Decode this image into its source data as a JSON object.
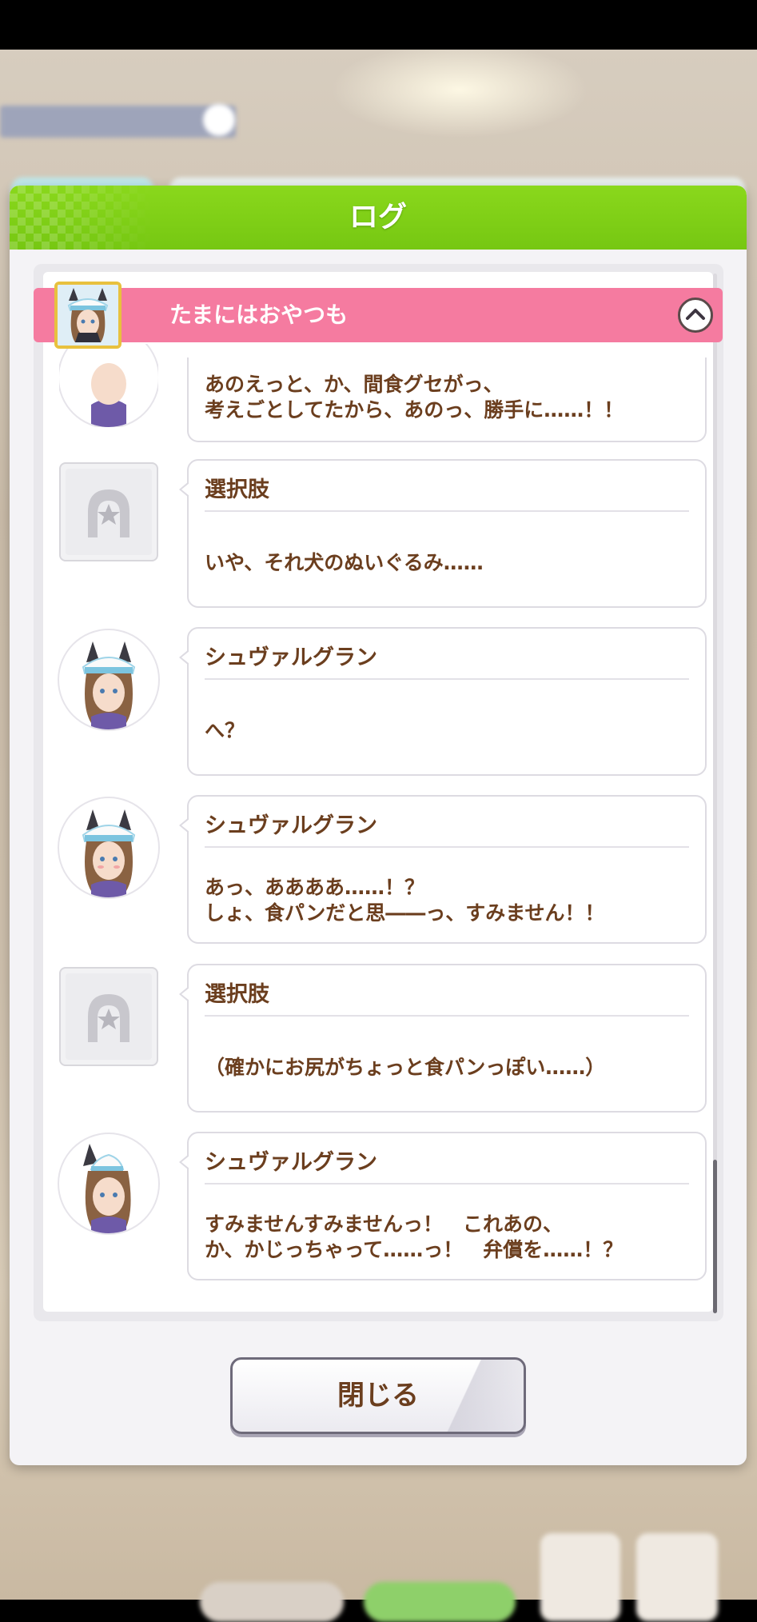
{
  "dialog": {
    "title": "ログ",
    "close_label": "閉じる"
  },
  "chapter": {
    "title": "たまにはおやつも"
  },
  "entries": [
    {
      "speaker": "",
      "lines": [
        "あのえっと、か、間食グセがっ、",
        "考えごとしてたから、あのっ、勝手に……！！"
      ]
    },
    {
      "speaker": "選択肢",
      "lines": [
        "いや、それ犬のぬいぐるみ……"
      ]
    },
    {
      "speaker": "シュヴァルグラン",
      "lines": [
        "へ？"
      ]
    },
    {
      "speaker": "シュヴァルグラン",
      "lines": [
        "あっ、ああああ……！？",
        "しょ、食パンだと思――っ、すみません！！"
      ]
    },
    {
      "speaker": "選択肢",
      "lines": [
        "（確かにお尻がちょっと食パンっぽい……）"
      ]
    },
    {
      "speaker": "シュヴァルグラン",
      "lines": [
        "すみませんすみませんっ！　これあの、",
        "か、かじっちゃって……っ！　弁償を……！？"
      ]
    }
  ],
  "icons": {
    "character": "character-portrait-icon",
    "choice": "horseshoe-choice-icon",
    "collapse": "chevron-up-icon"
  },
  "colors": {
    "header_green": "#7dcc16",
    "chapter_pink": "#f57ba0",
    "text_brown": "#6b3e1e"
  }
}
